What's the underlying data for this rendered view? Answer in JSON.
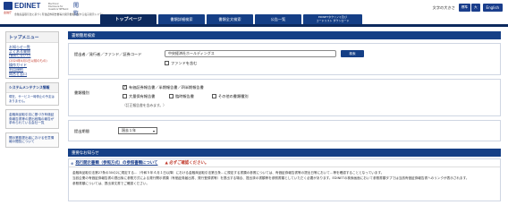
{
  "header": {
    "logo_sub": "金融庁",
    "logo_text": "EDINET",
    "logo_tag": "Electronic Disclosure for Investors' NETwork",
    "logo_kanji": "閲覧",
    "logo_caption": "金融商品取引法に基づく有価証券報告書等の開示書類に関する電子開示システム",
    "nav": [
      {
        "label": "トップページ",
        "active": true
      },
      {
        "label": "書類詳細検索"
      },
      {
        "label": "書類全文検索"
      },
      {
        "label": "公告一覧"
      },
      {
        "label_line1": "EDINETタクソノミ及び",
        "label_line2": "コードリスト ダウンロード"
      }
    ],
    "font_size_label": "文字の大きさ",
    "font_btn_standard": "標準",
    "font_btn_large": "大",
    "lang_btn": "English"
  },
  "sidebar": {
    "menu_title": "トップメニュー",
    "links": [
      "お知らせ一覧",
      "よくある質問",
      "(使用しない方)",
      "操作ガイド",
      "利用規約",
      "問合せ窓口"
    ],
    "red_note": "(2024年4月1日以前のもの)",
    "maint_title": "システムメンテナンス情報",
    "maint_msg": "現在、サービス一時停止の予定はありません。",
    "banner1": "金融商品取引法に基づき有価証券報告書等の提出段階の報告が求められている会社一覧",
    "banner2": "開示業務提出者における任意情報の閲覧について"
  },
  "main": {
    "section_title": "書類簡易検索",
    "filer_label": "提出者／発行者／ファンド／証券コード",
    "filer_value": "中央経済社ホールディングス",
    "search_btn": "検索",
    "fund_checkbox": "ファンドを含む",
    "doctype_label": "書類種別",
    "doctypes": [
      {
        "label": "有価証券報告書／半期報告書／四半期報告書",
        "checked": true
      },
      {
        "label": "大量保有報告書",
        "checked": false
      },
      {
        "label": "臨時報告書",
        "checked": false
      },
      {
        "label": "その他の書類種別",
        "checked": false
      }
    ],
    "doctype_note": "（訂正報告書を含みます。）",
    "period_label": "提出期間",
    "period_value": "過去１年",
    "period_chev": "▾"
  },
  "notice": {
    "section_title": "重要なお知らせ",
    "item_title": "発行開示書類（参照方式）の参照書類について",
    "item_warning": "▲ 必ずご確認ください。",
    "body_line1": "金融商品取引法第27条の30の2に規定する…（令和５年４月１日以降）における金融商品取引法第五条…に規定する書類の参照については、有価証券報告書等の提出日等において…等を確認することとなっています。",
    "body_line2": "当該企業の有価証券報告書の提出後に参照方式による発行開示書類（有価証券届出書、発行登録書等）を提出する場合、提出済の書類等を参照書類としていただく必要があります。EDINETの検索画面において参照書類タブでは当該有価証券報告書へのリンクが表示されます。",
    "body_line3": "参照書類については、提出済文書でご確認ください。"
  }
}
